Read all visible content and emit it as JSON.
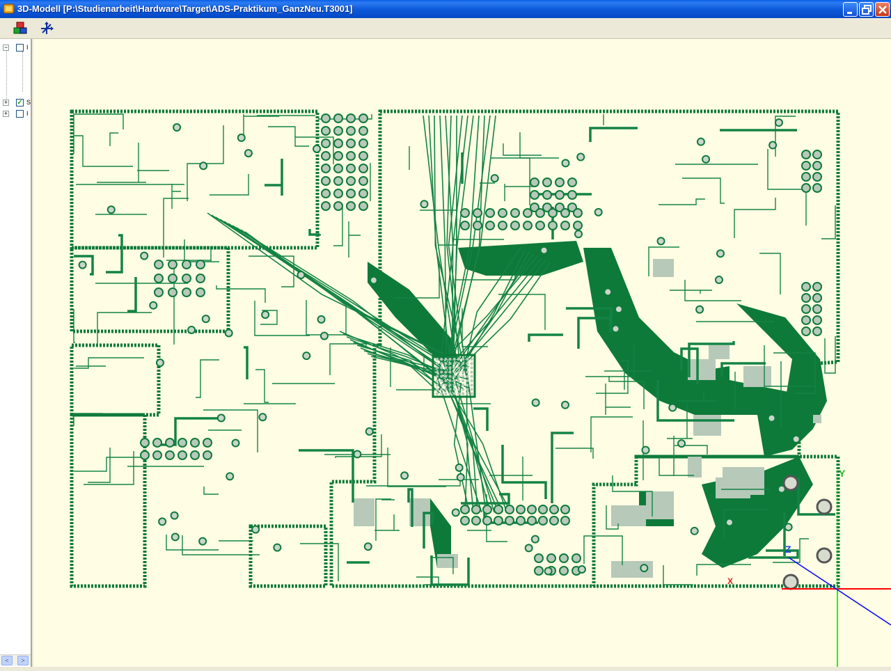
{
  "window": {
    "title": "3D-Modell  [P:\\Studienarbeit\\Hardware\\Target\\ADS-Praktikum_GanzNeu.T3001]",
    "controls": [
      "minimize",
      "maximize",
      "close"
    ]
  },
  "toolbar": {
    "buttons": [
      {
        "name": "layers-3d-button",
        "icon": "colored-blocks-icon"
      },
      {
        "name": "axis-orientation-button",
        "icon": "axis-arrows-icon"
      }
    ]
  },
  "tree": {
    "rows": [
      {
        "expander": "−",
        "checked": false,
        "label": "I"
      },
      {
        "expander": "+",
        "checked": true,
        "label": "S"
      },
      {
        "expander": "+",
        "checked": false,
        "label": "I"
      }
    ]
  },
  "axes": {
    "x_label": "X",
    "y_label": "Y",
    "z_label": "Z",
    "colors": {
      "x": "#FF0000",
      "y": "#00FF00",
      "z": "#0000FF"
    }
  },
  "colors": {
    "background": "#FFFDE4",
    "copper_dark": "#0E7A3A",
    "copper_light": "#2E9A58",
    "pad_gray": "#B8C8B8",
    "titlebar": "#0A58D8"
  }
}
